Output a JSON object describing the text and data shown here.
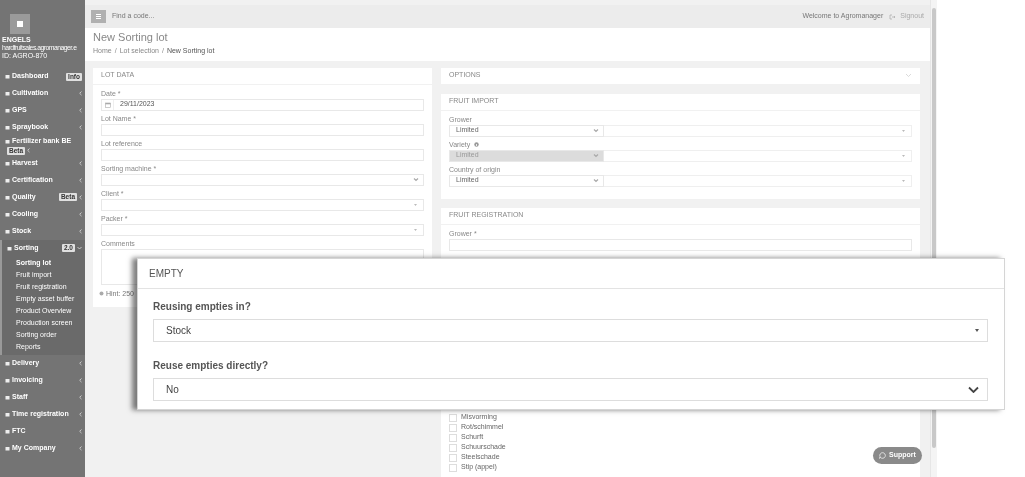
{
  "sidebar": {
    "brand": {
      "name": "ENGELS",
      "domain": "hardfruitsales.agromanager.e",
      "id": "ID: AGRO-870"
    },
    "items": [
      {
        "label": "Dashboard",
        "badge": "Info"
      },
      {
        "label": "Cultivation",
        "expanded": false
      },
      {
        "label": "GPS",
        "expanded": false
      },
      {
        "label": "Spraybook",
        "expanded": false
      },
      {
        "label": "Fertilizer bank BE",
        "badge": "Beta",
        "expanded": false
      },
      {
        "label": "Harvest",
        "expanded": false
      },
      {
        "label": "Certification",
        "expanded": false
      },
      {
        "label": "Quality",
        "badge": "Beta",
        "expanded": false
      },
      {
        "label": "Cooling",
        "expanded": false
      },
      {
        "label": "Stock",
        "expanded": false
      },
      {
        "label": "Sorting",
        "badge": "2.0",
        "expanded": true,
        "children": [
          {
            "label": "Sorting lot",
            "selected": true
          },
          {
            "label": "Fruit import",
            "selected": false
          },
          {
            "label": "Fruit registration",
            "selected": false
          },
          {
            "label": "Empty asset buffer",
            "selected": false
          },
          {
            "label": "Product Overview",
            "selected": false
          },
          {
            "label": "Production screen",
            "selected": false
          },
          {
            "label": "Sorting order",
            "selected": false
          },
          {
            "label": "Reports",
            "selected": false
          }
        ]
      },
      {
        "label": "Delivery",
        "expanded": false
      },
      {
        "label": "Invoicing",
        "expanded": false
      },
      {
        "label": "Staff",
        "expanded": false
      },
      {
        "label": "Time registration",
        "expanded": false
      },
      {
        "label": "FTC",
        "expanded": false
      },
      {
        "label": "My Company",
        "expanded": false
      }
    ]
  },
  "topbar": {
    "search": {
      "placeholder": "Find a code..."
    },
    "welcome": "Welcome to Agromanager",
    "signout": "Signout"
  },
  "page": {
    "title": "New Sorting lot",
    "breadcrumb": [
      "Home",
      "Lot selection",
      "New Sorting lot"
    ],
    "separator": "/"
  },
  "lot_data": {
    "title": "LOT DATA",
    "fields": [
      {
        "kind": "date",
        "label": "Date *",
        "value": "29/11/2023"
      },
      {
        "kind": "text",
        "label": "Lot Name *"
      },
      {
        "kind": "text",
        "label": "Lot reference"
      },
      {
        "kind": "select",
        "label": "Sorting machine *"
      },
      {
        "kind": "combo",
        "label": "Client *"
      },
      {
        "kind": "combo",
        "label": "Packer *"
      },
      {
        "kind": "textarea",
        "label": "Comments"
      }
    ],
    "hint": "Hint: 250"
  },
  "options": {
    "title": "OPTIONS",
    "expanded": false
  },
  "fruit_import": {
    "title": "FRUIT IMPORT",
    "rows": [
      {
        "label": "Grower",
        "info": false,
        "filter": "Limited",
        "disabled": false
      },
      {
        "label": "Variety",
        "info": true,
        "filter": "Limited",
        "disabled": true
      },
      {
        "label": "Country of origin",
        "info": false,
        "filter": "Limited",
        "disabled": false
      }
    ]
  },
  "fruit_registration": {
    "title": "FRUIT REGISTRATION",
    "grower_label": "Grower *",
    "defects": [
      {
        "label": "Misvorming",
        "checked": false
      },
      {
        "label": "Rot/schimmel",
        "checked": false
      },
      {
        "label": "Schurft",
        "checked": false
      },
      {
        "label": "Schuurschade",
        "checked": false
      },
      {
        "label": "Steelschade",
        "checked": false
      },
      {
        "label": "Stip (appel)",
        "checked": false
      }
    ]
  },
  "support": "Support",
  "empty_dialog": {
    "title": "EMPTY",
    "fields": [
      {
        "kind": "combo",
        "label": "Reusing empties in?",
        "value": "Stock"
      },
      {
        "kind": "select",
        "label": "Reuse empties directly?",
        "value": "No"
      }
    ]
  }
}
